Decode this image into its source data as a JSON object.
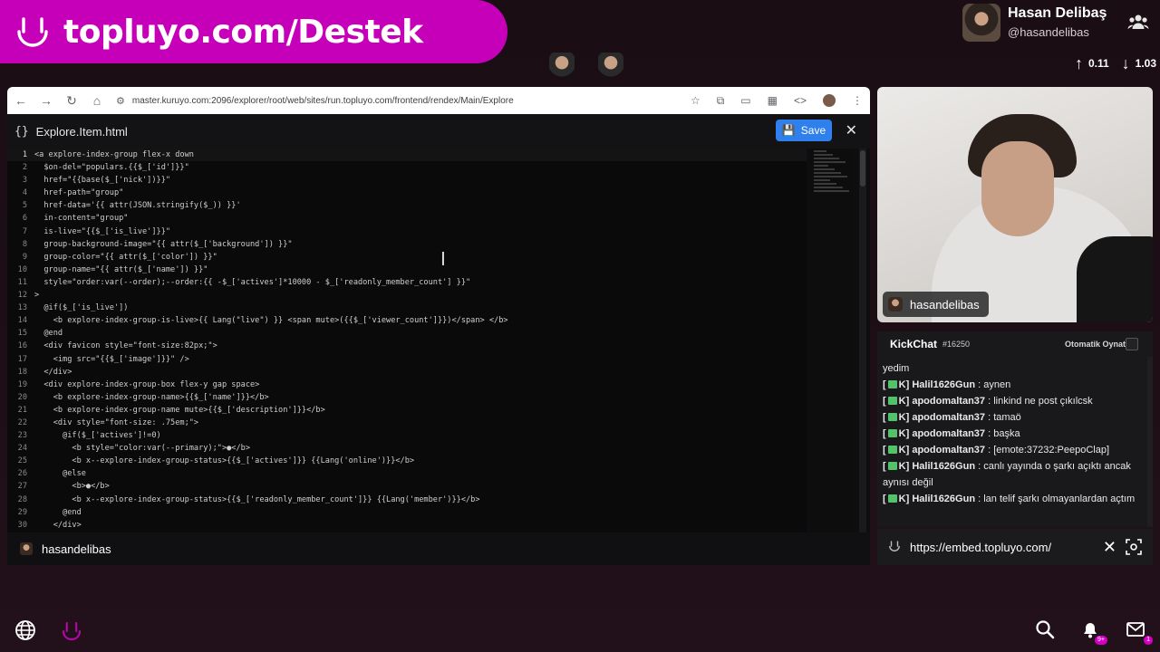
{
  "banner": {
    "text": "topluyo.com/Destek"
  },
  "profile": {
    "name": "Hasan Delibaş",
    "handle": "@hasandelibas",
    "up": "0.11",
    "down": "1.03"
  },
  "browser": {
    "url": "master.kuruyo.com:2096/explorer/root/web/sites/run.topluyo.com/frontend/rendex/Main/Explore",
    "filename": "Explore.Item.html",
    "save_label": "Save",
    "footer_user": "hasandelibas",
    "code": [
      "<a explore-index-group flex-x down",
      "  $on-del=\"populars.{{$_['id']}}\"",
      "  href=\"{{base($_['nick'])}}\"",
      "  href-path=\"group\"",
      "  href-data='{{ attr(JSON.stringify($_)) }}'",
      "  in-content=\"group\"",
      "  is-live=\"{{$_['is_live']}}\"",
      "  group-background-image=\"{{ attr($_['background']) }}\"",
      "  group-color=\"{{ attr($_['color']) }}\"",
      "  group-name=\"{{ attr($_['name']) }}\"",
      "  style=\"order:var(--order);--order:{{ -$_['actives']*10000 - $_['readonly_member_count'] }}\"",
      ">",
      "  @if($_['is_live'])",
      "    <b explore-index-group-is-live>{{ Lang(\"live\") }} <span mute>({{$_['viewer_count']}})</span> </b>",
      "  @end",
      "  <div favicon style=\"font-size:82px;\">",
      "    <img src=\"{{$_['image']}}\" />",
      "  </div>",
      "  <div explore-index-group-box flex-y gap space>",
      "    <b explore-index-group-name>{{$_['name']}}</b>",
      "    <b explore-index-group-name mute>{{$_['description']}}</b>",
      "    <div style=\"font-size: .75em;\">",
      "      @if($_['actives']!=0)",
      "        <b style=\"color:var(--primary);\">●</b>",
      "        <b x--explore-index-group-status>{{$_['actives']}} {{Lang('online')}}</b>",
      "      @else",
      "        <b>●</b>",
      "        <b x--explore-index-group-status>{{$_['readonly_member_count']}} {{Lang('member')}}</b>",
      "      @end",
      "    </div>"
    ]
  },
  "webcam": {
    "label": "hasandelibas"
  },
  "chat": {
    "title": "KickChat",
    "count": "#16250",
    "autoplay_label": "Otomatik Oynat",
    "messages": [
      {
        "user": "",
        "text": "yedim"
      },
      {
        "user": "Halil1626Gun",
        "text": "aynen"
      },
      {
        "user": "apodomaltan37",
        "text": "linkind ne post çıkılcsk"
      },
      {
        "user": "apodomaltan37",
        "text": "tamaö"
      },
      {
        "user": "apodomaltan37",
        "text": "başka"
      },
      {
        "user": "apodomaltan37",
        "text": "[emote:37232:PeepoClap]"
      },
      {
        "user": "Halil1626Gun",
        "text": "canlı yayında o şarkı açıktı ancak aynısı değil"
      },
      {
        "user": "Halil1626Gun",
        "text": "lan telif şarkı olmayanlardan açtım"
      }
    ]
  },
  "embed": {
    "url": "https://embed.topluyo.com/"
  },
  "dock": {
    "notif_badge": "9+",
    "mail_badge": "1"
  },
  "colors": {
    "banner": "#c500b8",
    "save": "#2f80ed",
    "accent": "#d400c4"
  }
}
